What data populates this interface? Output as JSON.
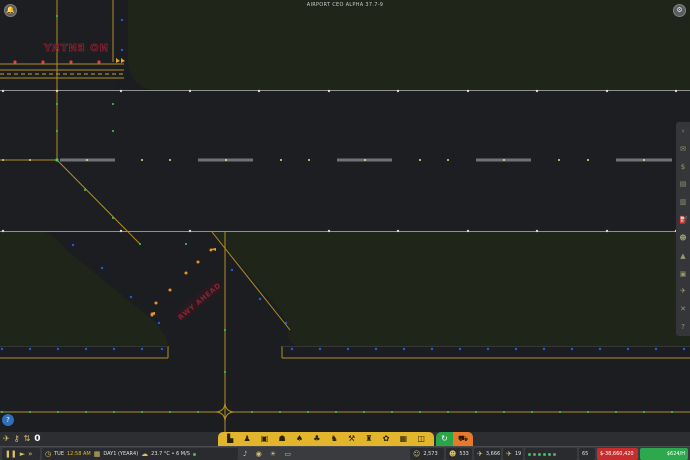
{
  "airport_name": "AIRPORT CEO ALPHA 37.7-9",
  "map_markings": {
    "no_entry": "NO ENTRY",
    "rwy_ahead": "RWY AHEAD"
  },
  "colors": {
    "grass": "#1f2619",
    "runway": "#1d1e22",
    "taxi_line": "#c9a227",
    "edge_blue": "#2a56e0",
    "centre_green": "#3fd05a",
    "runway_light": "#e8e8d8",
    "marking_red": "#8f2230"
  },
  "top_left_button_icon": "bell-icon",
  "top_right_button_icon": "gear-icon",
  "right_panel_icons": [
    "chevron-right-icon",
    "mail-icon",
    "money-icon",
    "chart-icon",
    "stats-icon",
    "pump-icon",
    "person-icon",
    "building-icon",
    "bus-icon",
    "plane-icon",
    "tools-icon",
    "help-icon"
  ],
  "help_label": "?",
  "toolbar": {
    "contracts_count": "0",
    "build_icons": [
      "desk-icon",
      "walker-icon",
      "bus-icon",
      "user-icon",
      "toilet-icon",
      "family-icon",
      "group-icon",
      "crane-icon",
      "chair-icon",
      "flower-icon",
      "table-icon",
      "doors-icon"
    ],
    "finance_tab_icon": "refresh-icon",
    "vehicles_tab_icon": "truck-icon"
  },
  "status_bar": {
    "day": "TUE",
    "time": "12:58 AM",
    "day_counter": "DAY1 (YEAR4)",
    "weather": "23.7 °C • 6 M/S",
    "passengers": "2,573",
    "employees": "533",
    "flights": "3,666",
    "aircraft": "19",
    "rating": "65",
    "balance": "$-38,660,420",
    "income_rate": "$624/H"
  }
}
